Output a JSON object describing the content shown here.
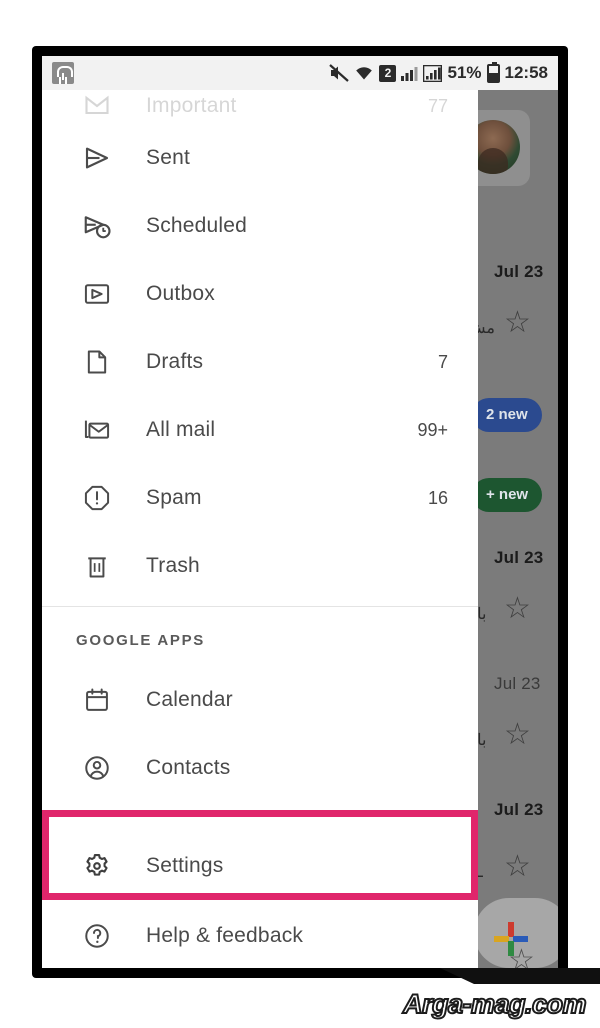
{
  "status_bar": {
    "notification_icon": "notification-chip-icon",
    "mute_icon": "volume-mute-icon",
    "wifi_icon": "wifi-icon",
    "sim_badge": "2",
    "signal_icon_1": "signal-bars-icon",
    "signal_icon_2": "signal-strength-icon",
    "battery_percent": "51%",
    "battery_icon": "battery-icon",
    "clock": "12:58"
  },
  "drawer": {
    "items": [
      {
        "label": "Important",
        "count": "77",
        "icon": "important-label-icon",
        "faded": true
      },
      {
        "label": "Sent",
        "count": "",
        "icon": "send-icon",
        "faded": false
      },
      {
        "label": "Scheduled",
        "count": "",
        "icon": "schedule-send-icon",
        "faded": false
      },
      {
        "label": "Outbox",
        "count": "",
        "icon": "outbox-icon",
        "faded": false
      },
      {
        "label": "Drafts",
        "count": "7",
        "icon": "draft-file-icon",
        "faded": false
      },
      {
        "label": "All mail",
        "count": "99+",
        "icon": "all-mail-icon",
        "faded": false
      },
      {
        "label": "Spam",
        "count": "16",
        "icon": "spam-report-icon",
        "faded": false
      },
      {
        "label": "Trash",
        "count": "",
        "icon": "trash-icon",
        "faded": false
      }
    ],
    "section_header": "GOOGLE APPS",
    "app_items": [
      {
        "label": "Calendar",
        "icon": "calendar-icon"
      },
      {
        "label": "Contacts",
        "icon": "contacts-icon"
      }
    ],
    "footer_items": [
      {
        "label": "Settings",
        "icon": "gear-icon"
      },
      {
        "label": "Help & feedback",
        "icon": "help-circle-icon"
      }
    ]
  },
  "highlight": {
    "target_label": "Settings",
    "color": "#e0266b"
  },
  "background_inbox": {
    "avatar": "user-avatar",
    "rows": [
      {
        "date": "Jul 23",
        "snippet": "مش",
        "star": "☆",
        "bold": true
      },
      {
        "date": "Jul 23",
        "snippet": "باب",
        "star": "☆",
        "bold": true
      },
      {
        "date": "Jul 23",
        "snippet": "باب",
        "star": "☆",
        "bold": false
      },
      {
        "date": "Jul 23",
        "snippet": "ـل",
        "star": "☆",
        "bold": true
      }
    ],
    "badges": [
      {
        "text": "2 new",
        "color": "#2b4a8f"
      },
      {
        "text": "+ new",
        "color": "#1d5630"
      }
    ],
    "compose_fab": "compose-fab"
  },
  "watermark": {
    "text": "Arga-mag.com"
  }
}
